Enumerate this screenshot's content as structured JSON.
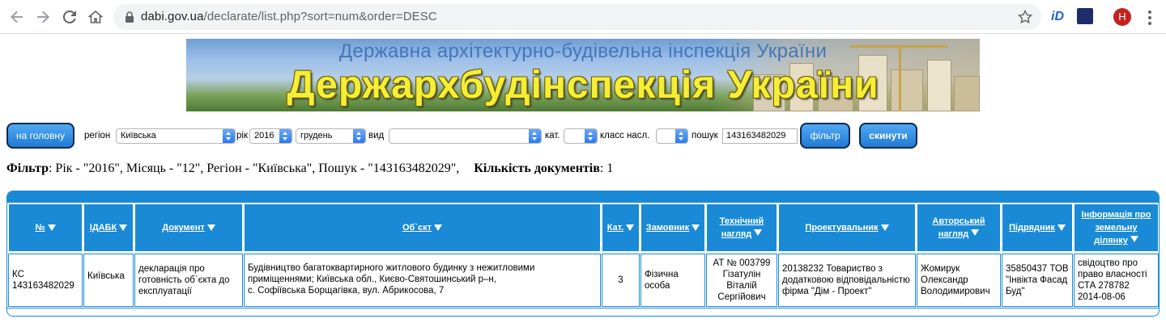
{
  "browser": {
    "url_host": "dabi.gov.ua",
    "url_path": "/declarate/list.php?sort=num&order=DESC",
    "ext_label": "iD",
    "avatar_letter": "Н"
  },
  "banner": {
    "subtitle": "Державна архітектурно-будівельна інспекція України",
    "title": "Держархбудінспекція України"
  },
  "toolbar": {
    "home_button": "на головну",
    "region_label": "регіон",
    "region_value": "Київська",
    "year_label": "рік",
    "year_value": "2016",
    "month_value": "грудень",
    "type_label": "вид",
    "type_value": "",
    "cat_label": "кат.",
    "cat_value": "",
    "class_label": "класс насл.",
    "class_value": "",
    "search_label": "пошук",
    "search_value": "143163482029",
    "filter_button": "фільтр",
    "reset_button": "скинути"
  },
  "summary": {
    "filter_label": "Фільтр",
    "filter_text": ": Рік - \"2016\", Місяць - \"12\", Регіон - \"Київська\", Пошук - \"143163482029\",",
    "count_label": "Кількість документів",
    "count_value": ": 1"
  },
  "table": {
    "headers": {
      "num": "№",
      "idabk": "ІДАБК",
      "document": "Документ",
      "object": "Об`єкт",
      "cat": "Кат.",
      "customer": "Замовник",
      "tech_l1": "Технічний",
      "tech_l2": "нагляд",
      "designer": "Проектувальник",
      "author_l1": "Авторський",
      "author_l2": "нагляд",
      "contractor": "Підрядник",
      "land_l1": "Інформація про",
      "land_l2": "земельну",
      "land_l3": "ділянку"
    },
    "row": {
      "num": "КС 143163482029",
      "idabk": "Київська",
      "document": "декларація про готовність об`єкта до експлуатації",
      "object_l1": "Будівництво багатоквартирного житлового будинку з нежитловими",
      "object_l2": "приміщеннями; Київська обл., Києво-Святошинський р–н,",
      "object_l3": "с. Софіївська Борщагівка, вул. Абрикосова, 7",
      "cat": "3",
      "customer": "Фізична особа",
      "tech": "АТ № 003799 Гізатулін Віталій Сергійович",
      "designer": "20138232 Товариство з додатковою відповідальністю фірма \"Дім - Проект\"",
      "author": "Жомирук Олександр Володимирович",
      "contractor": "35850437 ТОВ \"Інвікта Фасад Буд\"",
      "land": "свідоцтво про право власності СТА 278782 2014-08-06"
    }
  },
  "colors": {
    "table_blue": "#1a8ad6",
    "button_blue": "#1f7bd6",
    "banner_yellow": "#f4ee36"
  }
}
